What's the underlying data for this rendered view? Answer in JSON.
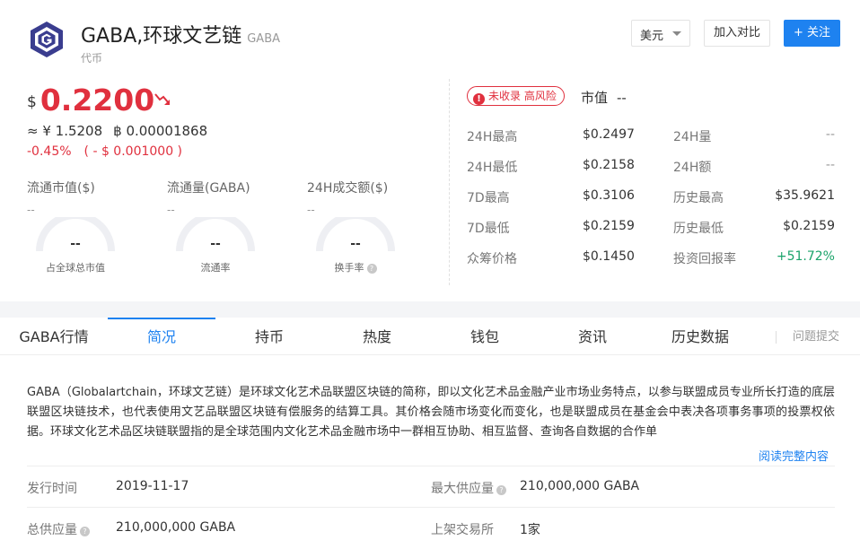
{
  "coin": {
    "name": "GABA,环球文艺链",
    "symbol": "GABA",
    "type": "代币",
    "logo_color": "#3a3d8f"
  },
  "header": {
    "currency": "美元",
    "compare_label": "加入对比",
    "follow_label": "+ 关注"
  },
  "price": {
    "currency_symbol": "$",
    "value": "0.2200",
    "cny": "≈ ¥ 1.5208",
    "btc": "฿ 0.00001868",
    "change_pct": "-0.45%",
    "change_abs": "( - $ 0.001000 )",
    "trend": "down",
    "down_color": "#e0303e"
  },
  "stats": [
    {
      "label": "流通市值($)",
      "value": "--",
      "gauge_value": "--",
      "gauge_label": "占全球总市值",
      "help": false
    },
    {
      "label": "流通量(GABA)",
      "value": "--",
      "gauge_value": "--",
      "gauge_label": "流通率",
      "help": false
    },
    {
      "label": "24H成交额($)",
      "value": "--",
      "gauge_value": "--",
      "gauge_label": "换手率",
      "help": true
    }
  ],
  "risk": {
    "badge": "未收录 高风险",
    "mcap_label": "市值",
    "mcap_value": "--"
  },
  "market": {
    "rows": [
      {
        "l1": "24H最高",
        "v1": "$0.2497",
        "l2": "24H量",
        "v2": "--"
      },
      {
        "l1": "24H最低",
        "v1": "$0.2158",
        "l2": "24H额",
        "v2": "--"
      },
      {
        "l1": "7D最高",
        "v1": "$0.3106",
        "l2": "历史最高",
        "v2": "$35.9621"
      },
      {
        "l1": "7D最低",
        "v1": "$0.2159",
        "l2": "历史最低",
        "v2": "$0.2159"
      },
      {
        "l1": "众筹价格",
        "v1": "$0.1450",
        "l2": "投资回报率",
        "v2": "+51.72%"
      }
    ],
    "positive_color": "#1aa36a"
  },
  "tabs": {
    "items": [
      "GABA行情",
      "简况",
      "持币",
      "热度",
      "钱包",
      "资讯",
      "历史数据"
    ],
    "active_index": 1,
    "report": "问题提交",
    "accent": "#1e82f0"
  },
  "description": {
    "text": "GABA（Globalartchain，环球文艺链）是环球文化艺术品联盟区块链的简称，即以文化艺术品金融产业市场业务特点，以参与联盟成员专业所长打造的底层联盟区块链技术，也代表使用文艺品联盟区块链有偿服务的结算工具。其价格会随市场变化而变化，也是联盟成员在基金会中表决各项事务事项的投票权依据。环球文化艺术品区块链联盟指的是全球范围内文化艺术品金融市场中一群相互协助、相互监督、查询各自数据的合作单",
    "read_more": "阅读完整内容"
  },
  "info": [
    {
      "label": "发行时间",
      "value": "2019-11-17",
      "help": false
    },
    {
      "label": "最大供应量",
      "value": "210,000,000 GABA",
      "help": true
    },
    {
      "label": "总供应量",
      "value": "210,000,000 GABA",
      "help": true
    },
    {
      "label": "上架交易所",
      "value": "1家",
      "help": false
    }
  ]
}
